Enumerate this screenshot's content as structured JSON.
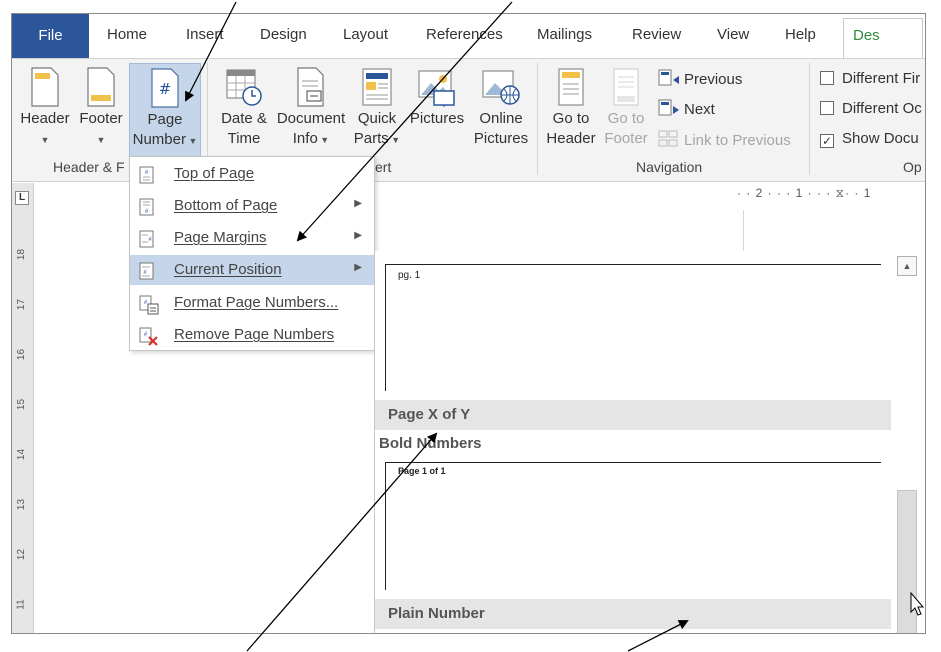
{
  "tabs": {
    "file": "File",
    "home": "Home",
    "insert": "Insert",
    "design": "Design",
    "layout": "Layout",
    "references": "References",
    "mailings": "Mailings",
    "review": "Review",
    "view": "View",
    "help": "Help",
    "design_tools": "Des"
  },
  "ribbon": {
    "header": {
      "label": "Header"
    },
    "footer": {
      "label": "Footer"
    },
    "page_number": {
      "line1": "Page",
      "line2": "Number"
    },
    "date_time": {
      "line1": "Date &",
      "line2": "Time"
    },
    "document_info": {
      "line1": "Document",
      "line2": "Info"
    },
    "quick_parts": {
      "line1": "Quick",
      "line2": "Parts"
    },
    "pictures": {
      "label": "Pictures"
    },
    "online_pictures": {
      "line1": "Online",
      "line2": "Pictures"
    },
    "go_to_header": {
      "line1": "Go to",
      "line2": "Header"
    },
    "go_to_footer": {
      "line1": "Go to",
      "line2": "Footer"
    },
    "previous": "Previous",
    "next": "Next",
    "link_to_previous": "Link to Previous",
    "different_first": "Different Fir",
    "different_odd": "Different Oc",
    "show_document": "Show Docu",
    "groups": {
      "header_footer": "Header & F",
      "insert": "ert",
      "navigation": "Navigation",
      "options": "Op"
    }
  },
  "menu": {
    "items": [
      {
        "label": "Top of Page",
        "has_submenu": false
      },
      {
        "label": "Bottom of Page",
        "has_submenu": true
      },
      {
        "label": "Page Margins",
        "has_submenu": true
      },
      {
        "label": "Current Position",
        "has_submenu": true
      },
      {
        "label": "Format Page Numbers...",
        "has_submenu": false
      },
      {
        "label": "Remove Page Numbers",
        "has_submenu": false
      }
    ],
    "highlighted": "Current Position"
  },
  "gallery": {
    "thumb1_text": "pg. 1",
    "heading1": "Page X of Y",
    "subheading": "Bold Numbers",
    "thumb2_text": "Page 1 of 1",
    "heading2": "Plain Number"
  },
  "ruler": {
    "horizontal": "· · 2 · · · 1 · · · ",
    "horizontal_end": "· · 1",
    "vertical_numbers": [
      "18",
      "17",
      "16",
      "15",
      "14",
      "13",
      "12",
      "11"
    ]
  },
  "icons": {
    "tab_stop": "L",
    "page_number_glyph": "#"
  }
}
